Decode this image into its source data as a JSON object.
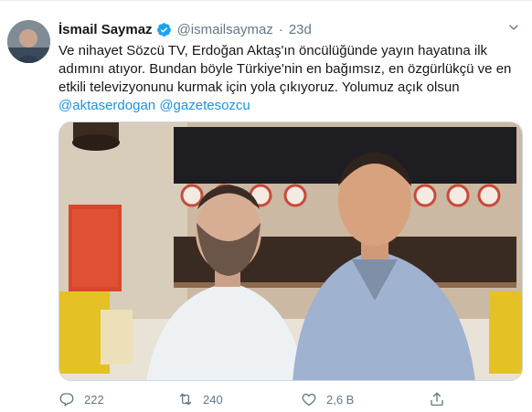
{
  "tweet": {
    "display_name": "İsmail Saymaz",
    "handle": "@ismailsaymaz",
    "separator": "·",
    "time": "23d",
    "text": "Ve nihayet Sözcü TV, Erdoğan Aktaş'ın öncülüğünde yayın hayatına ilk adımını atıyor. Bundan böyle Türkiye'nin en bağımsız, en özgürlükçü ve en etkili televizyonunu kurmak için yola çıkıyoruz. Yolumuz açık olsun",
    "mentions": [
      "@aktaserdogan",
      "@gazetesozcu"
    ]
  },
  "actions": {
    "reply_count": "222",
    "retweet_count": "240",
    "like_count": "2,6 B"
  },
  "icons": {
    "verified": "verified-badge-icon",
    "more": "chevron-down-icon",
    "reply": "reply-icon",
    "retweet": "retweet-icon",
    "like": "heart-icon",
    "share": "share-icon"
  },
  "colors": {
    "accent": "#1b95e0",
    "verified": "#1da1f2",
    "secondary_text": "#657786",
    "border": "#e6ecf0"
  }
}
